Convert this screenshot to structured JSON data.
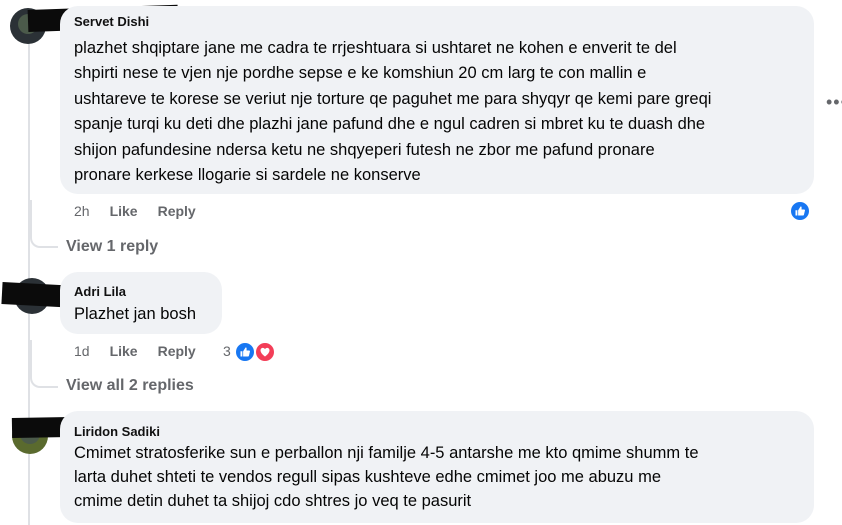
{
  "comments": [
    {
      "author": "Servet Dishi",
      "text": "plazhet shqiptare jane me cadra te rrjeshtuara si ushtaret ne kohen e enverit te del\nshpirti nese te vjen nje pordhe sepse e ke komshiun 20 cm larg te con mallin e\nushtareve te korese se veriut nje torture qe paguhet me para shyqyr qe kemi pare greqi\nspanje turqi ku deti dhe plazhi jane pafund dhe e ngul cadren si mbret ku te duash dhe\nshijon pafundesine ndersa ketu ne shqyeperi futesh ne zbor me pafund pronare\npronare kerkese llogarie si sardele ne konserve",
      "time": "2h",
      "like_label": "Like",
      "reply_label": "Reply",
      "reactions_count": "",
      "replies_link": "View 1 reply",
      "more_label": "•••"
    },
    {
      "author": "Adri Lila",
      "text": "Plazhet jan bosh",
      "time": "1d",
      "like_label": "Like",
      "reply_label": "Reply",
      "reactions_count": "3",
      "replies_link": "View all 2 replies"
    },
    {
      "author": "Liridon Sadiki",
      "text": "Cmimet stratosferike sun e perballon nji familje 4-5 antarshe me kto qmime shumm te\nlarta duhet shteti te vendos regull sipas kushteve edhe cmimet joo me abuzu me\ncmime detin duhet ta shijoj cdo shtres jo veq te pasurit"
    }
  ],
  "icons": {
    "like": "thumbs-up-icon",
    "love": "heart-icon",
    "more": "more-options-icon"
  },
  "colors": {
    "bubble": "#f0f2f5",
    "secondary_text": "#65676b",
    "like_blue": "#1877f2",
    "love_red": "#f33e58"
  }
}
